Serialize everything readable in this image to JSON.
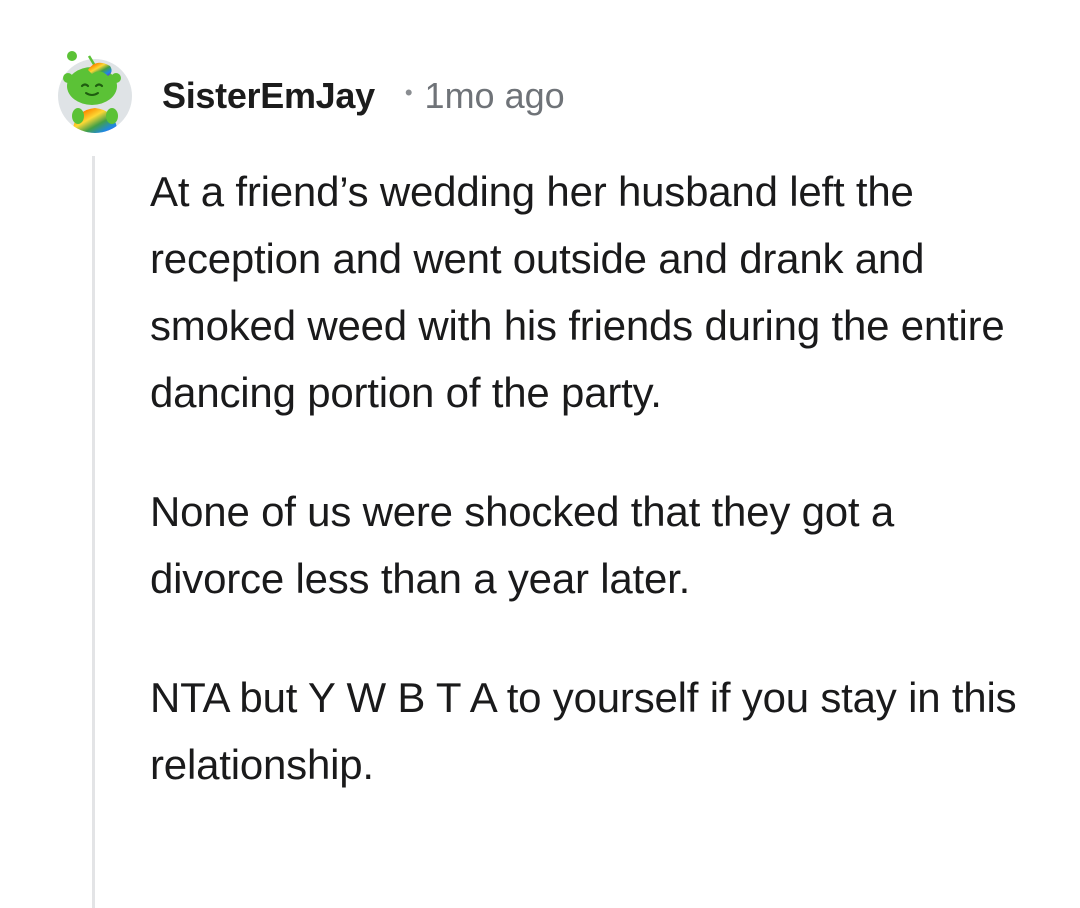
{
  "comment": {
    "username": "SisterEmJay",
    "separator": "•",
    "timestamp": "1mo ago",
    "avatar_icon": "snoo-avatar-icon",
    "paragraphs": [
      "At a friend’s wedding her husband left the reception and went outside and drank and smoked weed with his friends during the entire dancing portion of the party.",
      "None of us were shocked that they got a divorce less than a year later.",
      "NTA but Y W B T A to yourself if you stay in this relationship."
    ]
  },
  "colors": {
    "avatar_green": "#5bc236",
    "avatar_bg": "#dfe3e6",
    "thread_line": "#e3e4e6",
    "muted_text": "#6f7378"
  }
}
